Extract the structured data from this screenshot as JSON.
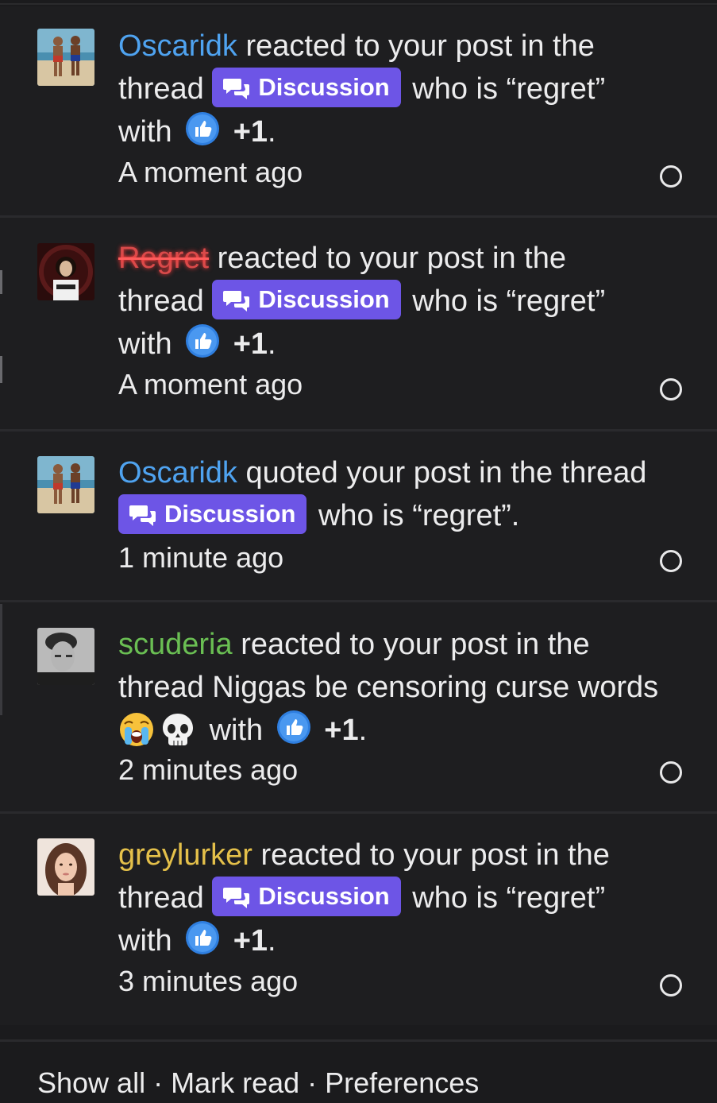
{
  "notifications": [
    {
      "username": "Oscaridk",
      "action": " reacted to your post in the",
      "thread_prefix": "thread",
      "badge": "Discussion",
      "thread_title": "who is “regret”",
      "with": "with",
      "reaction": "+1",
      "end": ".",
      "time": "A moment ago"
    },
    {
      "username": "Regret",
      "action": " reacted to your post in the",
      "thread_prefix": "thread",
      "badge": "Discussion",
      "thread_title": "who is “regret”",
      "with": "with",
      "reaction": "+1",
      "end": ".",
      "time": "A moment ago"
    },
    {
      "username": "Oscaridk",
      "action": " quoted your post in the thread",
      "badge": "Discussion",
      "thread_title": "who is “regret”.",
      "time": "1 minute ago"
    },
    {
      "username": "scuderia",
      "action": " reacted to your post in the",
      "thread_text": "thread Niggas be censoring curse words",
      "with": "with",
      "reaction": "+1",
      "end": ".",
      "time": "2 minutes ago"
    },
    {
      "username": "greylurker",
      "action": " reacted to your post in the",
      "thread_prefix": "thread",
      "badge": "Discussion",
      "thread_title": "who is “regret”",
      "with": "with",
      "reaction": "+1",
      "end": ".",
      "time": "3 minutes ago"
    }
  ],
  "footer": {
    "show_all": "Show all",
    "dot": "·",
    "mark_read": "Mark read",
    "preferences": "Preferences"
  },
  "colors": {
    "badge": "#6d55e6",
    "username_blue": "#4fa3f0",
    "username_green": "#6abf53",
    "username_yellow": "#e4c04a",
    "username_red": "#d94a4a"
  }
}
